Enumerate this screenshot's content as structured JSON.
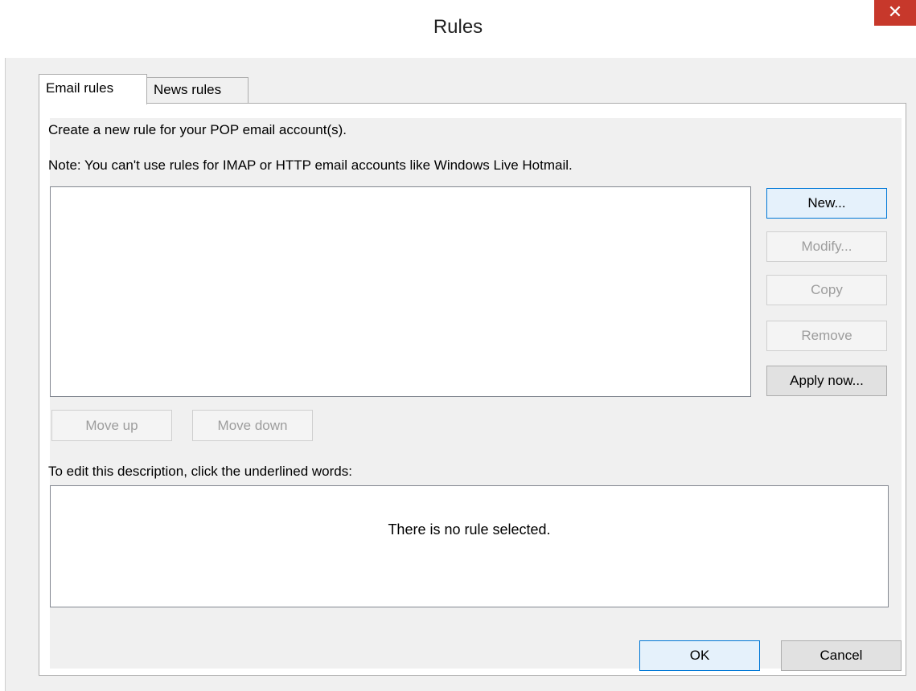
{
  "window": {
    "title": "Rules",
    "close_glyph": "✕"
  },
  "tabs": [
    {
      "label": "Email rules",
      "selected": true
    },
    {
      "label": "News rules",
      "selected": false
    }
  ],
  "email_rules": {
    "intro": "Create a new rule for your POP email account(s).",
    "note": "Note: You can't use rules for IMAP or HTTP email accounts like Windows Live Hotmail.",
    "rules_list": [],
    "side_buttons": [
      {
        "label": "New...",
        "enabled": true
      },
      {
        "label": "Modify...",
        "enabled": false
      },
      {
        "label": "Copy",
        "enabled": false
      },
      {
        "label": "Remove",
        "enabled": false
      },
      {
        "label": "Apply now...",
        "enabled": true
      }
    ],
    "move_up_label": "Move up",
    "move_down_label": "Move down",
    "description_label": "To edit this description, click the underlined words:",
    "description_text": "There is no rule selected."
  },
  "footer": {
    "ok_label": "OK",
    "cancel_label": "Cancel"
  },
  "colors": {
    "close_button": "#c7382b",
    "default_button_border": "#0078d7",
    "dialog_background": "#f0f0f0"
  }
}
